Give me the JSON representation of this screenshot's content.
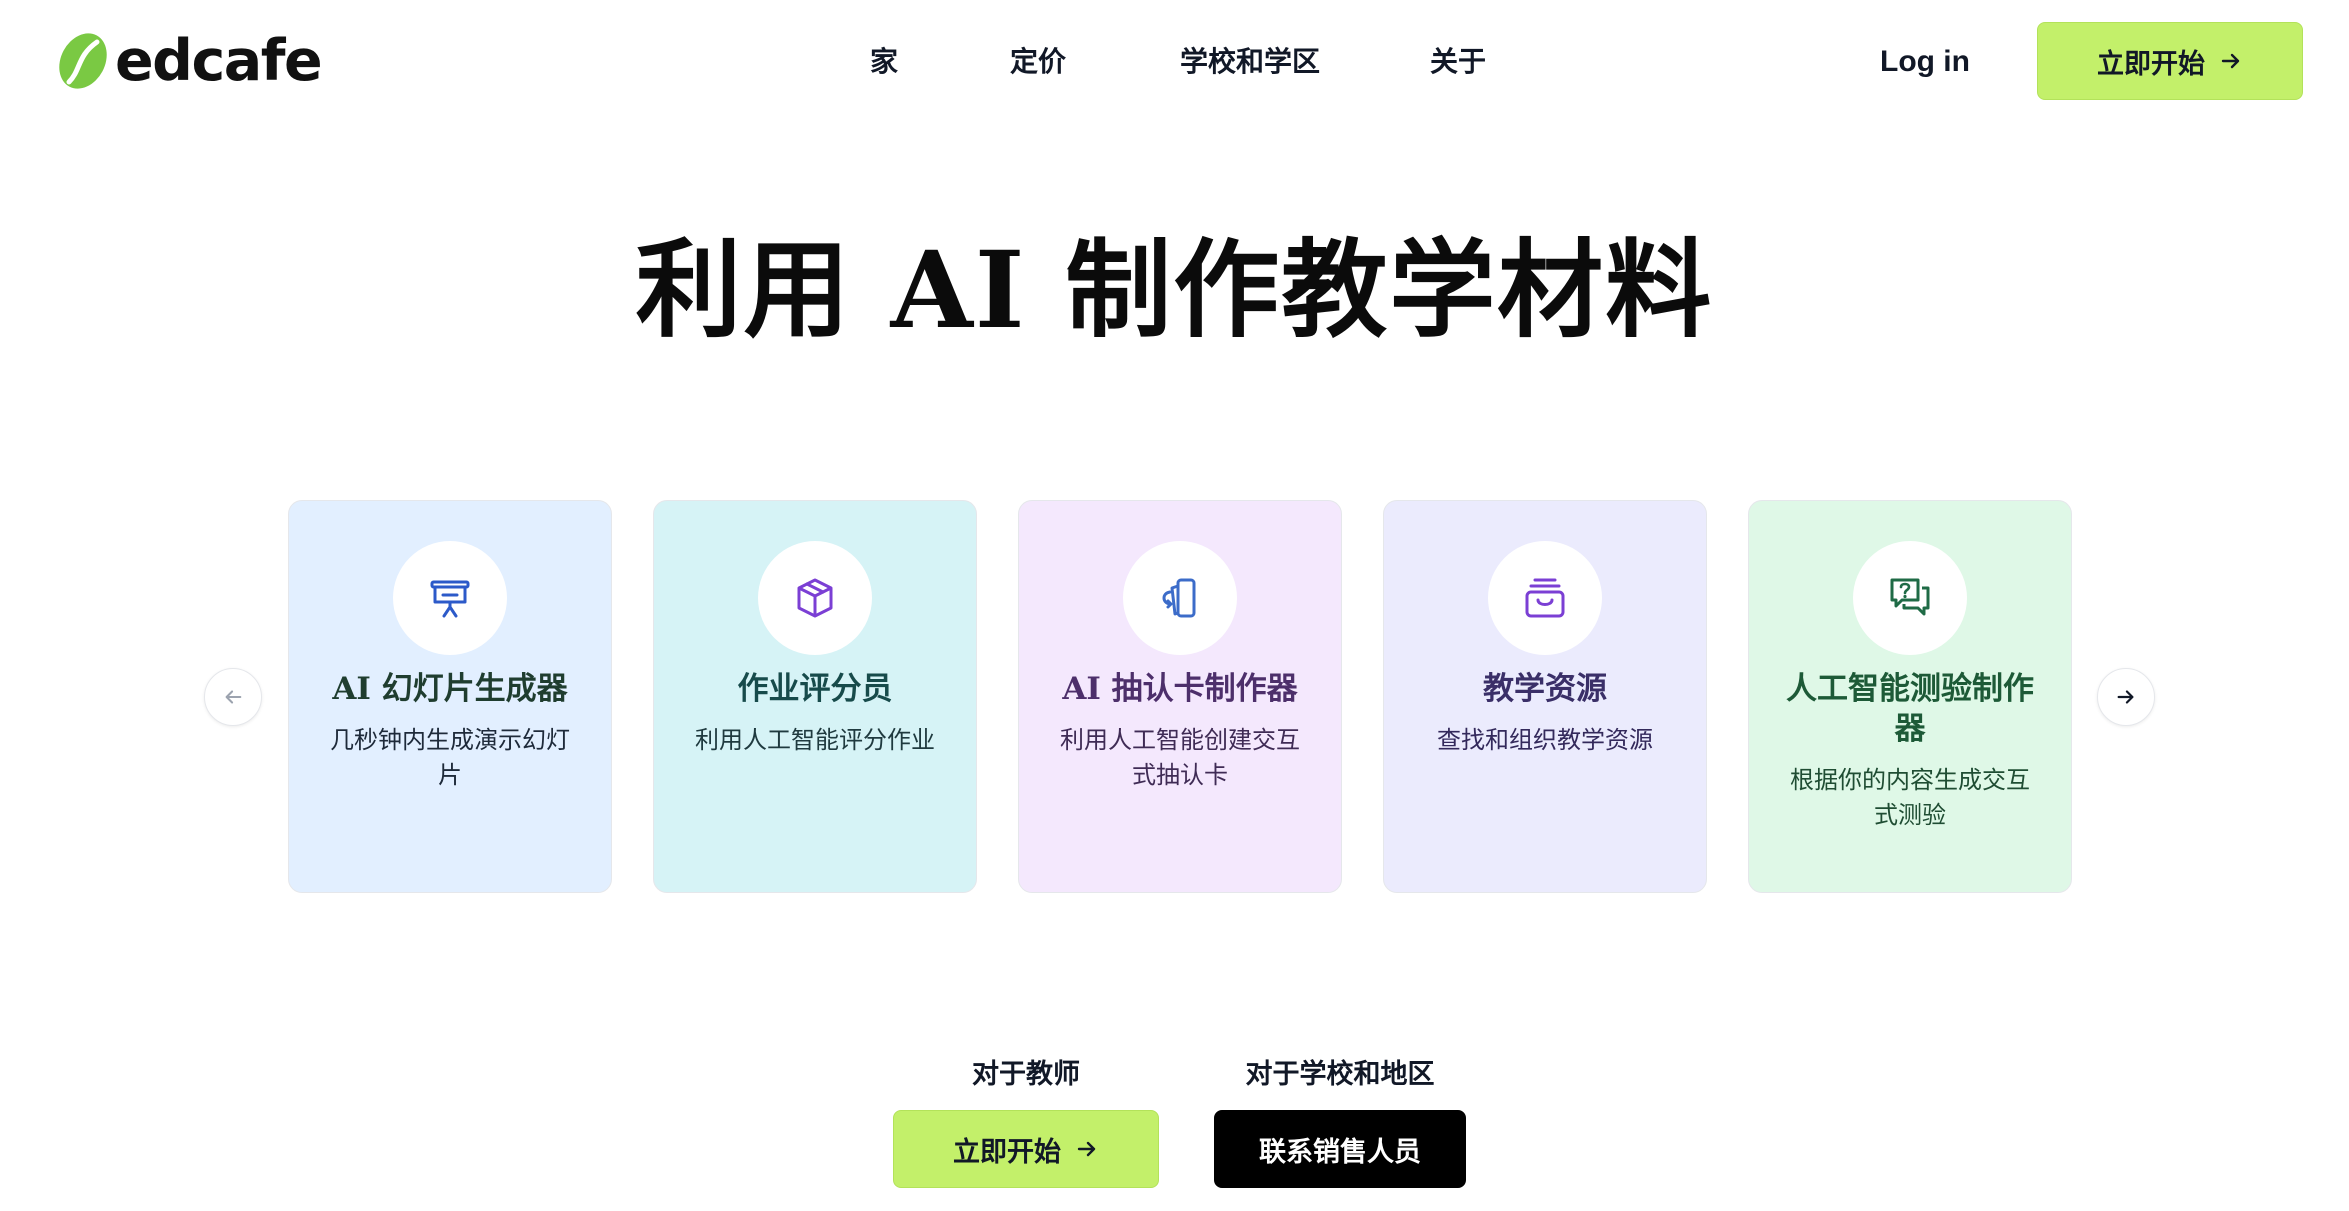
{
  "brand": {
    "name": "edcafe",
    "accent_color": "#c3f06a",
    "logo_color": "#7ac943"
  },
  "nav": {
    "items": [
      {
        "label": "家"
      },
      {
        "label": "定价"
      },
      {
        "label": "学校和学区"
      },
      {
        "label": "关于"
      }
    ],
    "login_label": "Log in",
    "cta_label": "立即开始"
  },
  "hero": {
    "title": "利用 AI 制作教学材料"
  },
  "carousel": {
    "prev_icon": "arrow-left-icon",
    "next_icon": "arrow-right-icon",
    "cards": [
      {
        "title": "AI 幻灯片生成器",
        "description": "几秒钟内生成演示幻灯片",
        "icon": "presentation-icon",
        "bg_color": "#e2efff",
        "icon_color": "#2c5ac9"
      },
      {
        "title": "作业评分员",
        "description": "利用人工智能评分作业",
        "icon": "box-icon",
        "bg_color": "#d6f3f6",
        "icon_color": "#7b3fd4"
      },
      {
        "title": "AI 抽认卡制作器",
        "description": "利用人工智能创建交互式抽认卡",
        "icon": "flashcards-icon",
        "bg_color": "#f4e8fd",
        "icon_color": "#3c6cc9"
      },
      {
        "title": "教学资源",
        "description": "查找和组织教学资源",
        "icon": "archive-icon",
        "bg_color": "#ebebfd",
        "icon_color": "#7b3fd4"
      },
      {
        "title": "人工智能测验制作器",
        "description": "根据你的内容生成交互式测验",
        "icon": "quiz-chat-icon",
        "bg_color": "#dff8e7",
        "icon_color": "#1f6b46"
      }
    ]
  },
  "bottom": {
    "teachers_label": "对于教师",
    "teachers_button": "立即开始",
    "schools_label": "对于学校和地区",
    "schools_button": "联系销售人员"
  }
}
